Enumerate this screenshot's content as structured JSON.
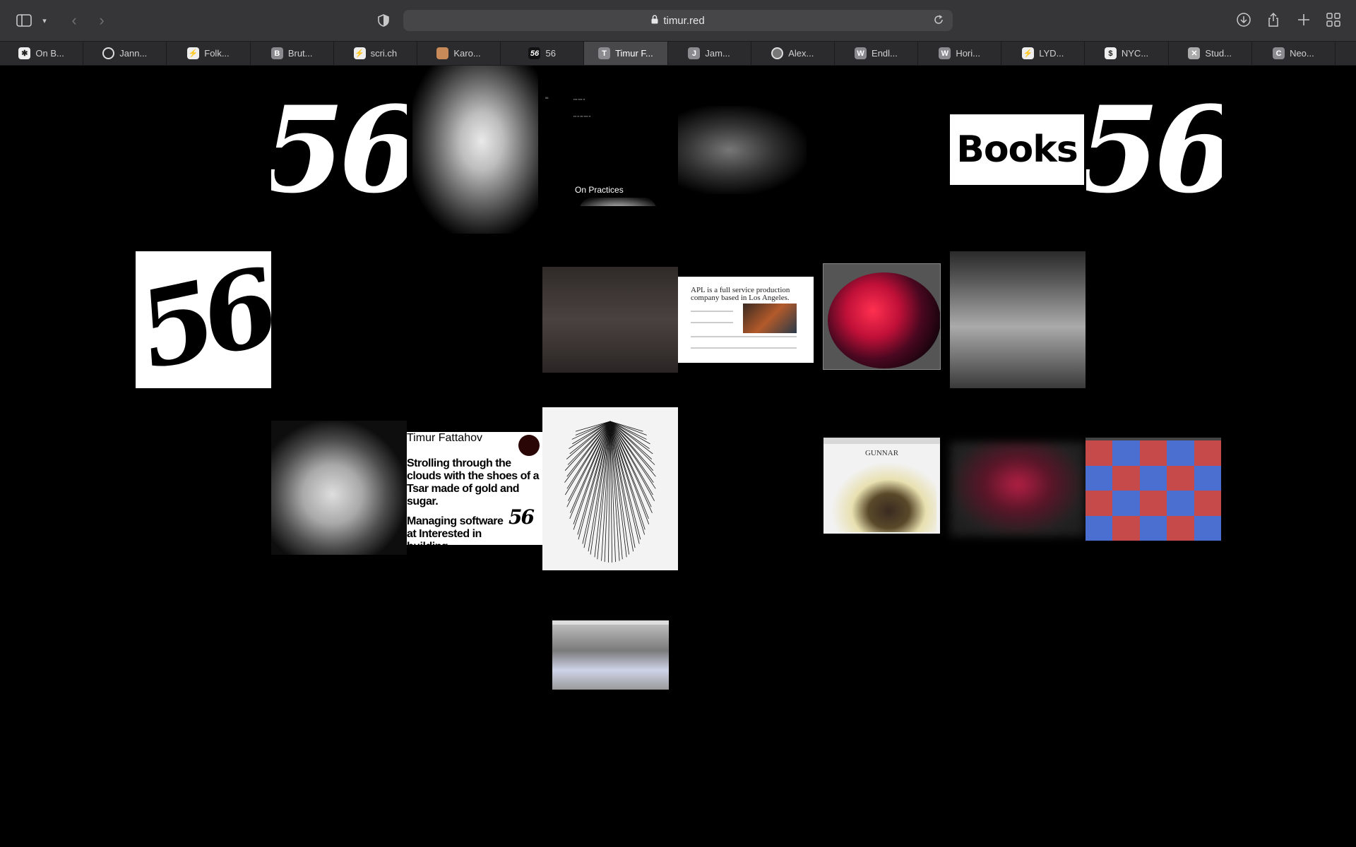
{
  "browser": {
    "url": "timur.red",
    "tabs": [
      {
        "label": "On B...",
        "favicon": "asterisk-icon"
      },
      {
        "label": "Jann...",
        "favicon": "circle-icon"
      },
      {
        "label": "Folk...",
        "favicon": "bolt-icon"
      },
      {
        "label": "Brut...",
        "favicon": "B"
      },
      {
        "label": "scri.ch",
        "favicon": "bolt-icon"
      },
      {
        "label": "Karo...",
        "favicon": "image-icon"
      },
      {
        "label": "56",
        "favicon": "56"
      },
      {
        "label": "Timur F...",
        "favicon": "T",
        "active": true
      },
      {
        "label": "Jam...",
        "favicon": "J"
      },
      {
        "label": "Alex...",
        "favicon": "globe-icon"
      },
      {
        "label": "Endl...",
        "favicon": "W"
      },
      {
        "label": "Hori...",
        "favicon": "W"
      },
      {
        "label": "LYD...",
        "favicon": "bolt-icon"
      },
      {
        "label": "NYC...",
        "favicon": "$"
      },
      {
        "label": "Stud...",
        "favicon": "x-icon"
      },
      {
        "label": "Neo...",
        "favicon": "C"
      }
    ]
  },
  "content": {
    "big56_left": "56",
    "big56_right": "56",
    "books": "Books",
    "wordmark56": "56",
    "practices_title": "On Practices",
    "apl_heading": "APL is a full service production company based in Los Angeles.",
    "tsar": {
      "name": "Timur Fattahov",
      "line1": "Strolling through the clouds with the shoes of a Tsar made of gold and sugar.",
      "line2": "Managing software at Interested in building communities and",
      "mark": "56"
    },
    "gunnar_title": "GUNNAR"
  }
}
